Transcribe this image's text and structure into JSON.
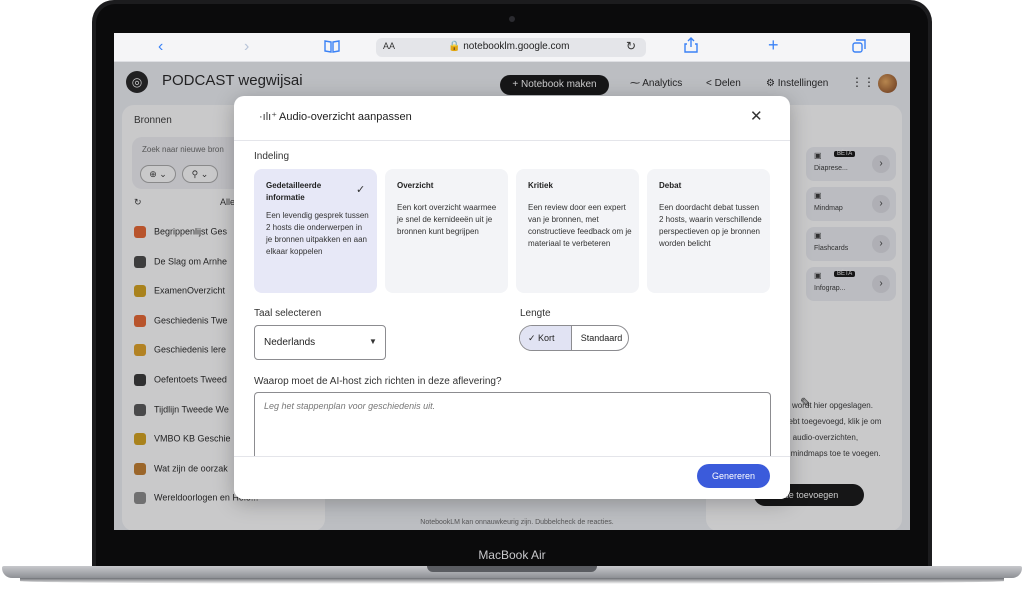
{
  "device": {
    "label": "MacBook Air"
  },
  "browser": {
    "url_aa": "AA",
    "url": "notebooklm.google.com",
    "icons": [
      "back-icon",
      "forward-icon",
      "bookmarks-icon",
      "reload-icon",
      "share-icon",
      "new-tab-icon",
      "tabs-icon"
    ]
  },
  "header": {
    "title": "PODCAST wegwijsai",
    "new_notebook": "+ Notebook maken",
    "analytics": "Analytics",
    "share": "Delen",
    "settings": "Instellingen"
  },
  "sources": {
    "title": "Bronnen",
    "search_placeholder": "Zoek naar nieuwe bron",
    "select_all": "Alle",
    "items": [
      {
        "label": "Begrippenlijst Ges",
        "color": "#e8632c"
      },
      {
        "label": "De Slag om Arnhe",
        "color": "#444444"
      },
      {
        "label": "ExamenOverzicht",
        "color": "#d4a017"
      },
      {
        "label": "Geschiedenis Twe",
        "color": "#e8632c"
      },
      {
        "label": "Geschiedenis lere",
        "color": "#e0a020"
      },
      {
        "label": "Oefentoets Tweed",
        "color": "#333333"
      },
      {
        "label": "Tijdlijn Tweede We",
        "color": "#555555"
      },
      {
        "label": "VMBO KB Geschie",
        "color": "#d4a017"
      },
      {
        "label": "Wat zijn de oorzak",
        "color": "#c27b2a"
      },
      {
        "label": "Wereldoorlogen en Holo...",
        "color": "#888888"
      }
    ]
  },
  "studio": {
    "cards": [
      {
        "label": "Diaprese...",
        "badge": "BÈTA"
      },
      {
        "label": "Mindmap",
        "badge": ""
      },
      {
        "label": "Flashcards",
        "badge": ""
      },
      {
        "label": "Infograp...",
        "badge": "BÈTA"
      }
    ],
    "empty_lines": [
      "wordt hier opgeslagen.",
      "hebt toegevoegd, klik je om",
      "d audio-overzichten,",
      "n mindmaps toe te voegen."
    ],
    "add_note": "titie toevoegen"
  },
  "footer_note": "NotebookLM kan onnauwkeurig zijn. Dubbelcheck de reacties.",
  "modal": {
    "title": "Audio-overzicht aanpassen",
    "format_label": "Indeling",
    "formats": [
      {
        "title": "Gedetailleerde informatie",
        "desc": "Een levendig gesprek tussen 2 hosts die onderwerpen in je bronnen uitpakken en aan elkaar koppelen",
        "selected": true
      },
      {
        "title": "Overzicht",
        "desc": "Een kort overzicht waarmee je snel de kernideeën uit je bronnen kunt begrijpen",
        "selected": false
      },
      {
        "title": "Kritiek",
        "desc": "Een review door een expert van je bronnen, met constructieve feedback om je materiaal te verbeteren",
        "selected": false
      },
      {
        "title": "Debat",
        "desc": "Een doordacht debat tussen 2 hosts, waarin verschillende perspectieven op je bronnen worden belicht",
        "selected": false
      }
    ],
    "language_label": "Taal selecteren",
    "language_value": "Nederlands",
    "length_label": "Lengte",
    "length_options": [
      "Kort",
      "Standaard"
    ],
    "length_selected": "Kort",
    "focus_label": "Waarop moet de AI-host zich richten in deze aflevering?",
    "focus_placeholder": "Leg het stappenplan voor geschiedenis uit.",
    "generate": "Genereren"
  }
}
